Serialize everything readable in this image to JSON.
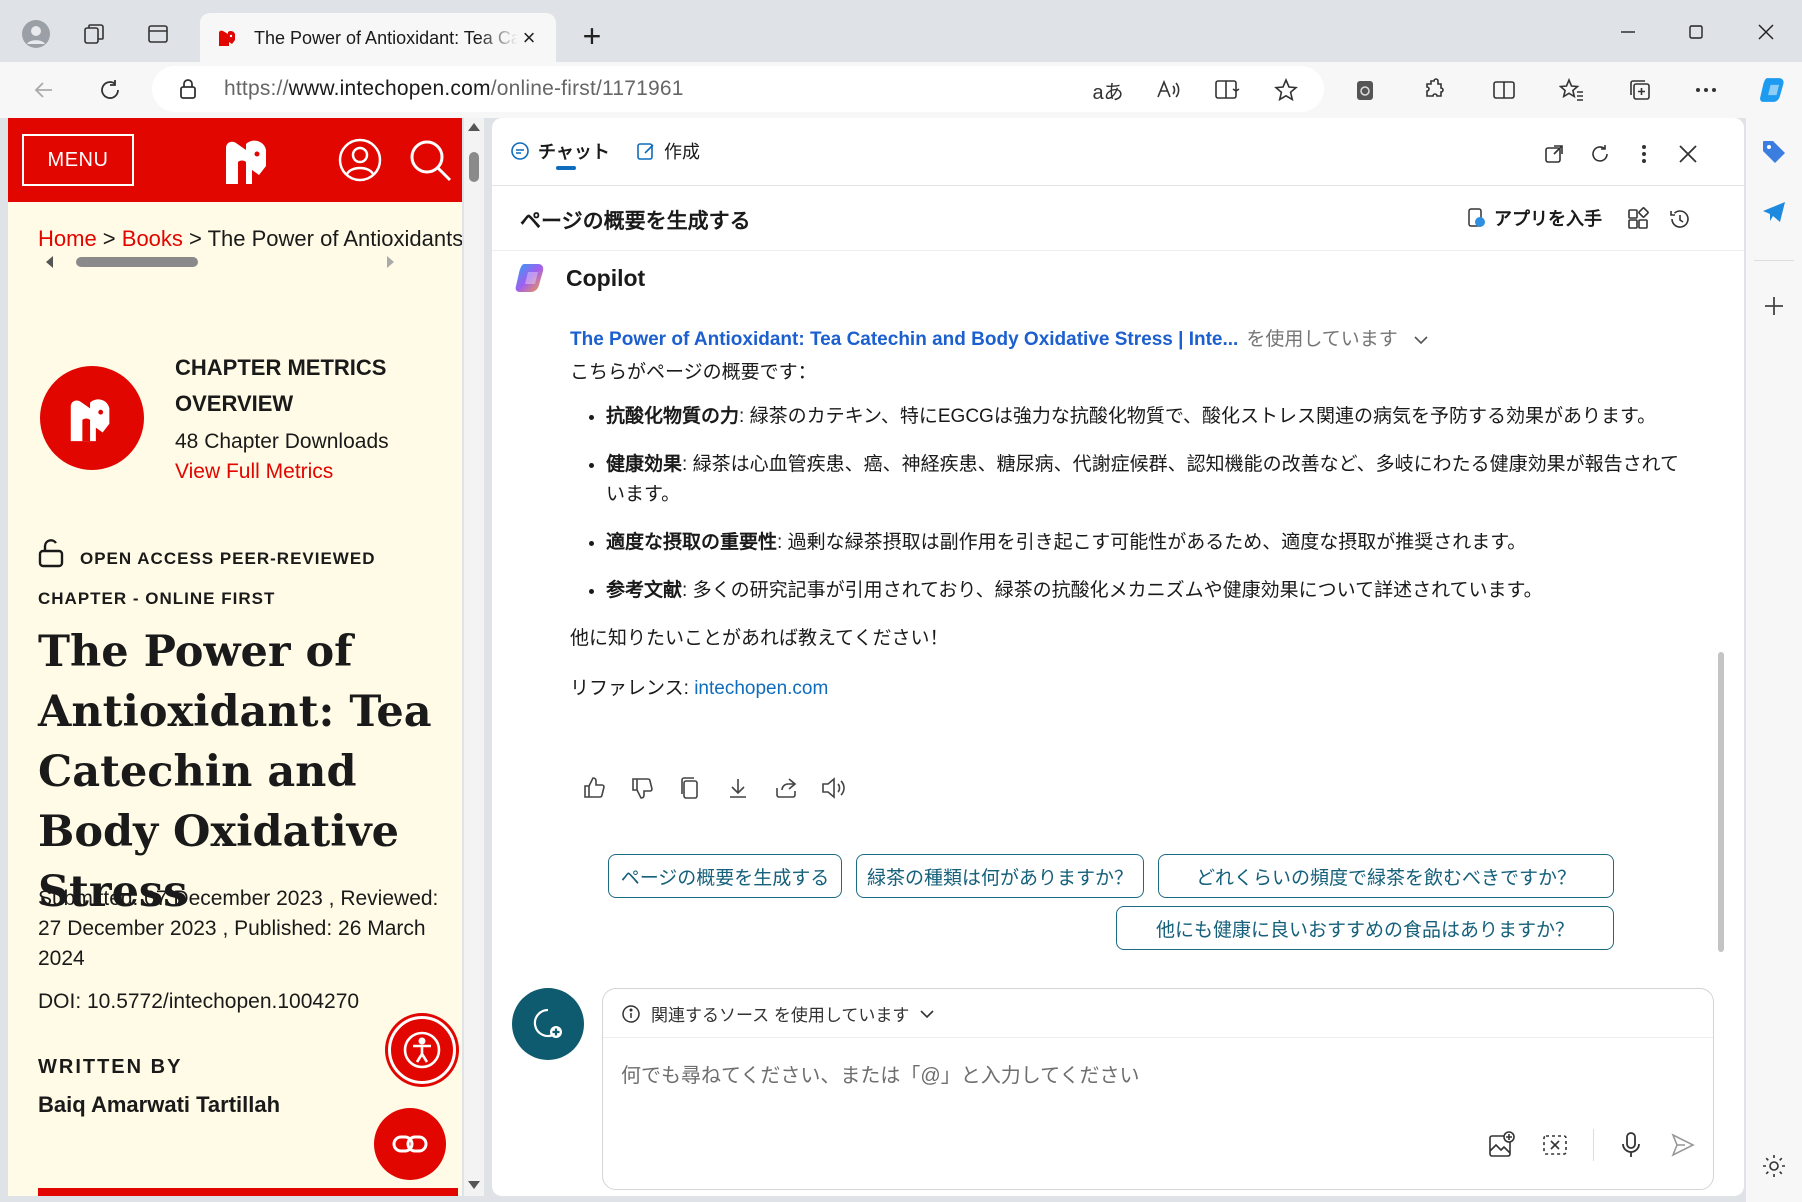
{
  "browser": {
    "tab_title": "The Power of Antioxidant: Tea Catechin and Body Oxidative Stress | IntechOpen",
    "new_tab_label": "+",
    "close_tab_label": "×",
    "url_prefix": "https://",
    "url_domain": "www.intechopen.com",
    "url_path": "/online-first/1171961",
    "read_aloud_label": "aあ",
    "win_min": "—",
    "win_close": "✕"
  },
  "site": {
    "menu_label": "MENU",
    "breadcrumb": {
      "home": "Home",
      "sep": " > ",
      "books": "Books",
      "current": "The Power of Antioxidants"
    },
    "metrics": {
      "title": "CHAPTER METRICS OVERVIEW",
      "downloads": "48 Chapter Downloads",
      "link": "View Full Metrics"
    },
    "access_line_1": "OPEN ACCESS PEER-REVIEWED",
    "access_line_2": "CHAPTER - ONLINE FIRST",
    "article_title": "The Power of Antioxidant: Tea Catechin and Body Oxidative Stress",
    "dates": "Submitted: 07 December 2023 , Reviewed: 27 December 2023 , Published: 26 March 2024",
    "doi": "DOI: 10.5772/intechopen.1004270",
    "written_by": "WRITTEN BY",
    "author": "Baiq Amarwati Tartillah"
  },
  "copilot": {
    "tab_chat": "チャット",
    "tab_compose": "作成",
    "subheader_title": "ページの概要を生成する",
    "get_app": "アプリを入手",
    "bot_name": "Copilot",
    "source_link": "The Power of Antioxidant: Tea Catechin and Body Oxidative Stress | Inte...",
    "source_using": "を使用しています",
    "intro": "こちらがページの概要です：",
    "bullets": [
      {
        "head": "抗酸化物質の力",
        "body": ": 緑茶のカテキン、特にEGCGは強力な抗酸化物質で、酸化ストレス関連の病気を予防する効果があります。"
      },
      {
        "head": "健康効果",
        "body": ": 緑茶は心血管疾患、癌、神経疾患、糖尿病、代謝症候群、認知機能の改善など、多岐にわたる健康効果が報告されています。"
      },
      {
        "head": "適度な摂取の重要性",
        "body": ": 過剰な緑茶摂取は副作用を引き起こす可能性があるため、適度な摂取が推奨されます。"
      },
      {
        "head": "参考文献",
        "body": ": 多くの研究記事が引用されており、緑茶の抗酸化メカニズムや健康効果について詳述されています。"
      }
    ],
    "closing": "他に知りたいことがあれば教えてください！",
    "reference_label": "リファレンス: ",
    "reference_link": "intechopen.com",
    "suggestions": [
      "ページの概要を生成する",
      "緑茶の種類は何がありますか？",
      "どれくらいの頻度で緑茶を飲むべきですか？",
      "他にも健康に良いおすすめの食品はありますか？"
    ],
    "compose_source": "関連するソース を使用しています",
    "compose_placeholder": "何でも尋ねてください、または「@」と入力してください"
  },
  "colors": {
    "brand_red": "#e10600",
    "page_bg": "#fffbe6",
    "copilot_teal": "#0e5a6e",
    "link_blue": "#1c5fcf"
  }
}
